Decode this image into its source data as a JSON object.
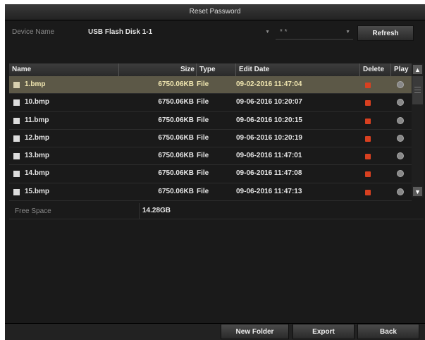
{
  "window": {
    "title": "Reset Password"
  },
  "device": {
    "label": "Device Name",
    "selected": "USB Flash Disk 1-1",
    "second_selected": "* *",
    "refresh_label": "Refresh"
  },
  "table": {
    "columns": {
      "name": "Name",
      "size": "Size",
      "type": "Type",
      "date": "Edit Date",
      "delete": "Delete",
      "play": "Play"
    },
    "rows": [
      {
        "name": "1.bmp",
        "size": "6750.06KB",
        "type": "File",
        "date": "09-02-2016 11:47:04"
      },
      {
        "name": "10.bmp",
        "size": "6750.06KB",
        "type": "File",
        "date": "09-06-2016 10:20:07"
      },
      {
        "name": "11.bmp",
        "size": "6750.06KB",
        "type": "File",
        "date": "09-06-2016 10:20:15"
      },
      {
        "name": "12.bmp",
        "size": "6750.06KB",
        "type": "File",
        "date": "09-06-2016 10:20:19"
      },
      {
        "name": "13.bmp",
        "size": "6750.06KB",
        "type": "File",
        "date": "09-06-2016 11:47:01"
      },
      {
        "name": "14.bmp",
        "size": "6750.06KB",
        "type": "File",
        "date": "09-06-2016 11:47:08"
      },
      {
        "name": "15.bmp",
        "size": "6750.06KB",
        "type": "File",
        "date": "09-06-2016 11:47:13"
      }
    ]
  },
  "free_space": {
    "label": "Free Space",
    "value": "14.28GB"
  },
  "footer": {
    "new_folder": "New Folder",
    "export": "Export",
    "back": "Back"
  },
  "colors": {
    "selected_row": "#5c5847",
    "delete_icon": "#d84020"
  },
  "icons": {
    "file": "file-icon",
    "delete": "delete-icon",
    "play": "play-icon",
    "scroll_up": "chevron-up-icon",
    "scroll_down": "chevron-down-icon"
  }
}
